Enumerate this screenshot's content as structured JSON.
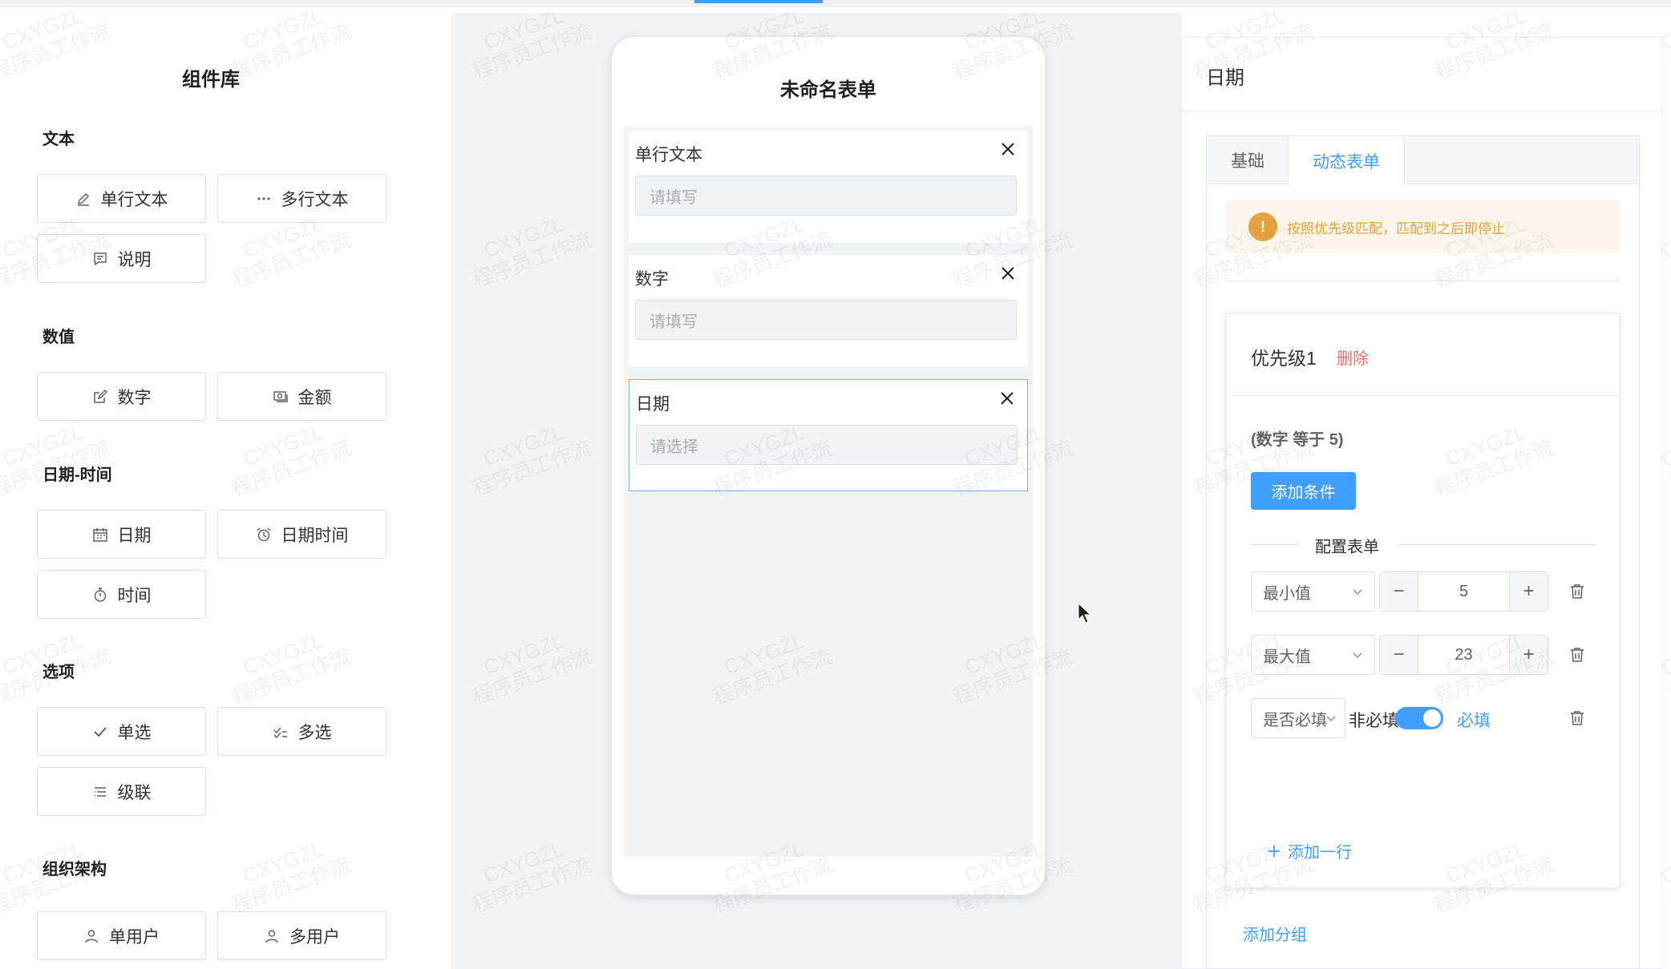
{
  "left": {
    "title": "组件库",
    "sections": {
      "text": {
        "title": "文本",
        "items": [
          "单行文本",
          "多行文本",
          "说明"
        ]
      },
      "number": {
        "title": "数值",
        "items": [
          "数字",
          "金额"
        ]
      },
      "datetime": {
        "title": "日期-时间",
        "items": [
          "日期",
          "日期时间",
          "时间"
        ]
      },
      "options": {
        "title": "选项",
        "items": [
          "单选",
          "多选",
          "级联"
        ]
      },
      "org": {
        "title": "组织架构",
        "items": [
          "单用户",
          "多用户"
        ]
      }
    }
  },
  "phone": {
    "title": "未命名表单",
    "fields": [
      {
        "label": "单行文本",
        "placeholder": "请填写"
      },
      {
        "label": "数字",
        "placeholder": "请填写"
      },
      {
        "label": "日期",
        "placeholder": "请选择"
      }
    ]
  },
  "right": {
    "title": "日期",
    "tabs": [
      "基础",
      "动态表单"
    ],
    "active_tab": "动态表单",
    "alert": "按照优先级匹配，匹配到之后即停止",
    "group": {
      "name": "优先级1",
      "delete_label": "删除",
      "condition": "(数字 等于 5)",
      "add_condition": "添加条件",
      "divider": "配置表单",
      "rows": [
        {
          "select": "最小值",
          "value": "5"
        },
        {
          "select": "最大值",
          "value": "23"
        },
        {
          "select": "是否必填",
          "off_label": "非必填",
          "on_label": "必填"
        }
      ],
      "add_row": "添加一行"
    },
    "add_group": "添加分组"
  },
  "colors": {
    "primary": "#409eff",
    "danger": "#f56c6c",
    "warning": "#e6a23c"
  },
  "watermark": {
    "line1": "CXYGZL",
    "line2": "程序员工作流"
  }
}
